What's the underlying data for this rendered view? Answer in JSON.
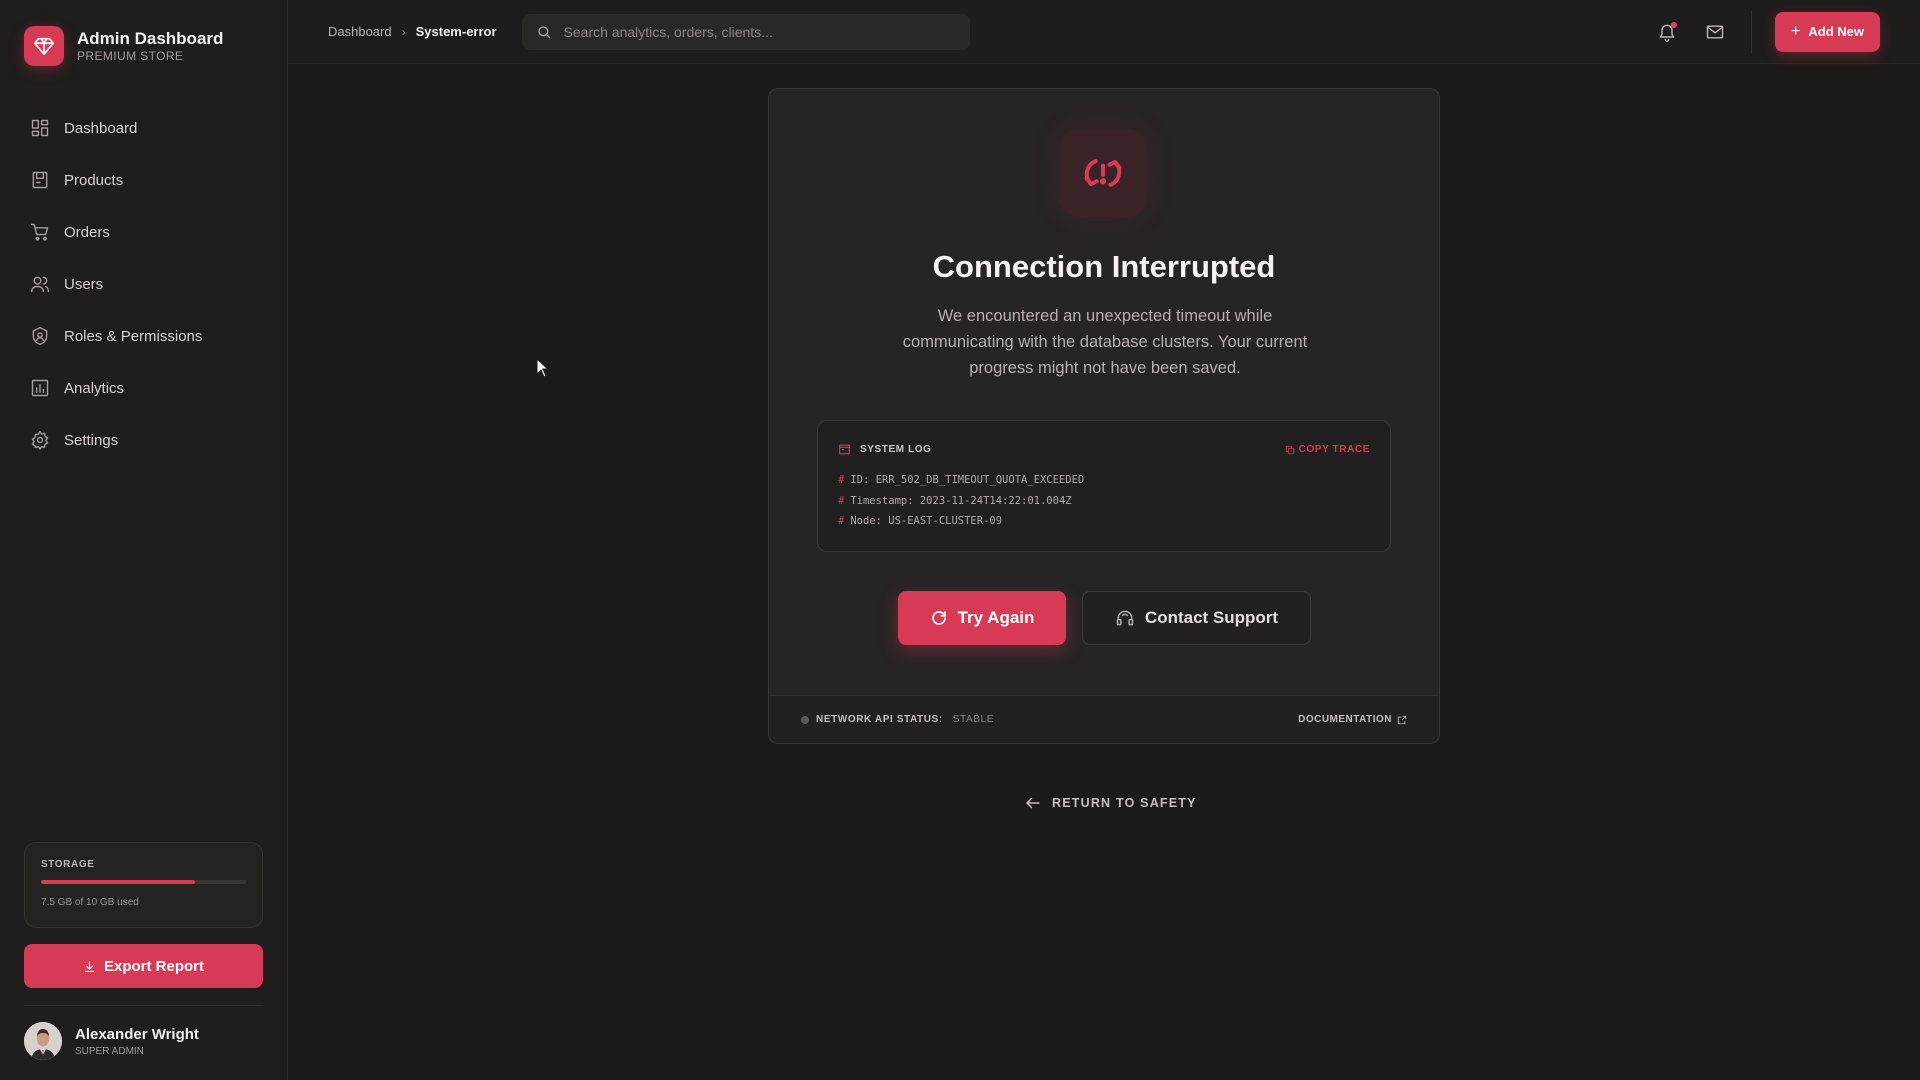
{
  "brand": {
    "title": "Admin Dashboard",
    "subtitle": "PREMIUM STORE"
  },
  "nav": [
    {
      "label": "Dashboard",
      "icon": "grid-icon"
    },
    {
      "label": "Products",
      "icon": "box-icon"
    },
    {
      "label": "Orders",
      "icon": "cart-icon"
    },
    {
      "label": "Users",
      "icon": "users-icon"
    },
    {
      "label": "Roles & Permissions",
      "icon": "shield-icon"
    },
    {
      "label": "Analytics",
      "icon": "chart-icon"
    },
    {
      "label": "Settings",
      "icon": "gear-icon"
    }
  ],
  "storage": {
    "label": "STORAGE",
    "used_fraction": 0.75,
    "text": "7.5 GB of 10 GB used"
  },
  "export_label": "Export Report",
  "user": {
    "name": "Alexander Wright",
    "role": "SUPER ADMIN"
  },
  "breadcrumb": {
    "parent": "Dashboard",
    "separator": "›",
    "current": "System-error"
  },
  "search": {
    "placeholder": "Search analytics, orders, clients..."
  },
  "add_new_label": "Add New",
  "error": {
    "title": "Connection Interrupted",
    "description": "We encountered an unexpected timeout while communicating with the database clusters. Your current progress might not have been saved.",
    "log": {
      "title": "SYSTEM LOG",
      "copy_label": "COPY TRACE",
      "lines": [
        "ID: ERR_502_DB_TIMEOUT_QUOTA_EXCEEDED",
        "Timestamp: 2023-11-24T14:22:01.004Z",
        "Node: US-EAST-CLUSTER-09"
      ]
    },
    "try_again_label": "Try Again",
    "contact_support_label": "Contact Support",
    "status_key": "NETWORK API STATUS:",
    "status_value": "STABLE",
    "documentation_label": "DOCUMENTATION"
  },
  "return_label": "RETURN TO SAFETY",
  "colors": {
    "accent": "#d63a55",
    "background": "#1c1a1a",
    "card": "#272424"
  }
}
